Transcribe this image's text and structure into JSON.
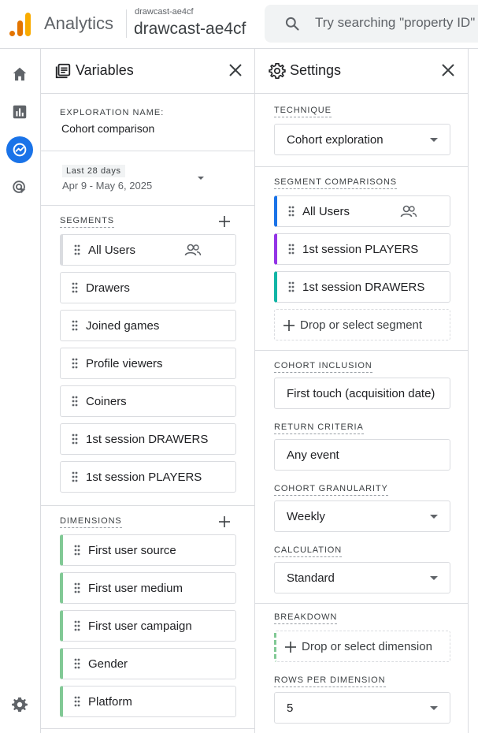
{
  "header": {
    "app_name": "Analytics",
    "account_small": "drawcast-ae4cf",
    "account_name": "drawcast-ae4cf",
    "search_placeholder": "Try searching \"property ID\""
  },
  "colors": {
    "accent": "#1a73e8",
    "dimension": "#81c995",
    "segment_players": "#9334e6",
    "segment_drawers": "#12b5a6",
    "logo_orange": "#f9ab00",
    "logo_dark_orange": "#e37400"
  },
  "nav": [
    {
      "icon": "home-icon",
      "active": false
    },
    {
      "icon": "reports-icon",
      "active": false
    },
    {
      "icon": "explore-icon",
      "active": true
    },
    {
      "icon": "advertising-icon",
      "active": false
    },
    {
      "icon": "admin-gear-icon",
      "active": false
    }
  ],
  "variables": {
    "title": "Variables",
    "exploration_name_label": "EXPLORATION NAME:",
    "exploration_name": "Cohort comparison",
    "date_label": "Last 28 days",
    "date_range": "Apr 9 - May 6, 2025",
    "segments_label": "SEGMENTS",
    "segments": [
      "All Users",
      "Drawers",
      "Joined games",
      "Profile viewers",
      "Coiners",
      "1st session DRAWERS",
      "1st session PLAYERS"
    ],
    "dimensions_label": "DIMENSIONS",
    "dimensions": [
      "First user source",
      "First user medium",
      "First user campaign",
      "Gender",
      "Platform"
    ]
  },
  "settings": {
    "title": "Settings",
    "technique_label": "TECHNIQUE",
    "technique": "Cohort exploration",
    "segment_comparisons_label": "SEGMENT COMPARISONS",
    "segment_comparisons": [
      "All Users",
      "1st session PLAYERS",
      "1st session DRAWERS"
    ],
    "drop_segment": "Drop or select segment",
    "cohort_inclusion_label": "COHORT INCLUSION",
    "cohort_inclusion": "First touch (acquisition date)",
    "return_criteria_label": "RETURN CRITERIA",
    "return_criteria": "Any event",
    "cohort_granularity_label": "COHORT GRANULARITY",
    "cohort_granularity": "Weekly",
    "calculation_label": "CALCULATION",
    "calculation": "Standard",
    "breakdown_label": "BREAKDOWN",
    "drop_dimension": "Drop or select dimension",
    "rows_per_dimension_label": "ROWS PER DIMENSION",
    "rows_per_dimension": "5"
  }
}
